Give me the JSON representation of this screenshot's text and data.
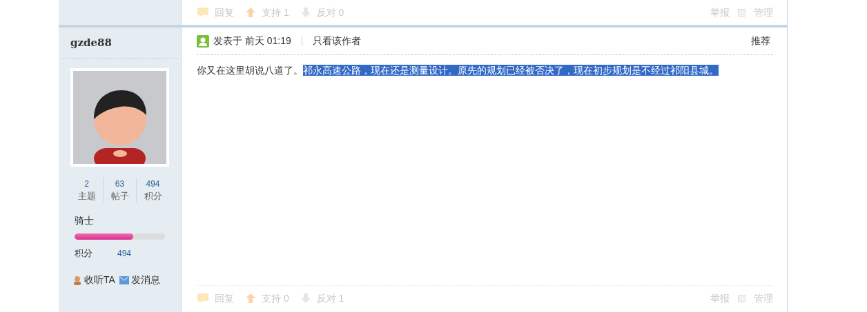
{
  "previous_post": {
    "actions": [
      {
        "kind": "reply",
        "label": "回复"
      },
      {
        "kind": "up",
        "label": "支持 1"
      },
      {
        "kind": "down",
        "label": "反对 0"
      }
    ],
    "report": "举报",
    "manage": {
      "label": "管理",
      "checked": false
    }
  },
  "post": {
    "author": {
      "name": "gzde88",
      "stats": [
        {
          "value": "2",
          "label": "主题"
        },
        {
          "value": "63",
          "label": "帖子"
        },
        {
          "value": "494",
          "label": "积分"
        }
      ],
      "rank": "骑士",
      "level": 0.65,
      "points_label": "积分",
      "points": "494",
      "links": [
        {
          "kind": "follow",
          "label": "收听TA"
        },
        {
          "kind": "message",
          "label": "发消息"
        }
      ]
    },
    "posted": "发表于 前天 01:19",
    "only_author": "只看该作者",
    "recommend": "推荐",
    "body": [
      {
        "text": "你又在这里胡说八道了。",
        "selected": false
      },
      {
        "text": "祁永高速公路，现在还是测量设计。原先的规划已经被否决了，现在初步规划是不经过祁阳县城。",
        "selected": true
      }
    ],
    "actions": [
      {
        "kind": "reply",
        "label": "回复"
      },
      {
        "kind": "up",
        "label": "支持 0"
      },
      {
        "kind": "down",
        "label": "反对 1"
      }
    ],
    "report": "举报",
    "manage": {
      "label": "管理",
      "checked": false
    }
  }
}
